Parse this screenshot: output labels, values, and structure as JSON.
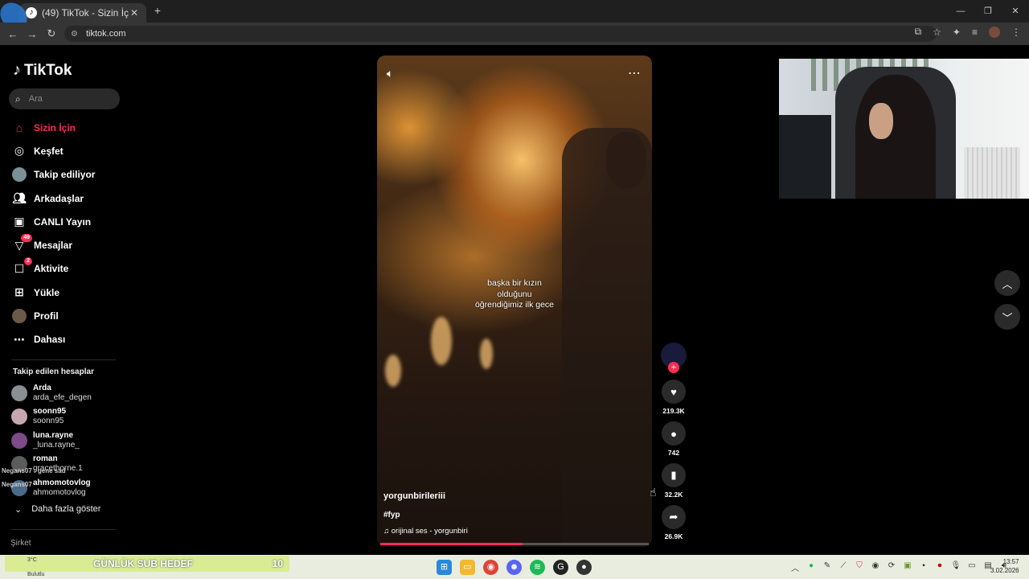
{
  "browser": {
    "tab_title": "(49) TikTok - Sizin İçin",
    "url": "tiktok.com",
    "tab_close": "✕",
    "new_tab": "+"
  },
  "sidebar": {
    "logo": "TikTok",
    "search_placeholder": "Ara",
    "nav": [
      {
        "label": "Sizin İçin",
        "icon": "home-icon",
        "active": true
      },
      {
        "label": "Keşfet",
        "icon": "compass-icon"
      },
      {
        "label": "Takip ediliyor",
        "icon": "avatar"
      },
      {
        "label": "Arkadaşlar",
        "icon": "friends-icon"
      },
      {
        "label": "CANLI Yayın",
        "icon": "live-icon"
      },
      {
        "label": "Mesajlar",
        "icon": "messages-icon",
        "badge": "49"
      },
      {
        "label": "Aktivite",
        "icon": "activity-icon",
        "badge": "2"
      },
      {
        "label": "Yükle",
        "icon": "upload-icon"
      },
      {
        "label": "Profil",
        "icon": "avatar"
      },
      {
        "label": "Dahası",
        "icon": "more-icon"
      }
    ],
    "following_title": "Takip edilen hesaplar",
    "following": [
      {
        "name": "Arda",
        "handle": "arda_efe_degen"
      },
      {
        "name": "soonn95",
        "handle": "soonn95"
      },
      {
        "name": "luna.rayne",
        "handle": "_luna.rayne_"
      },
      {
        "name": "roman",
        "handle": "gracethorne.1"
      },
      {
        "name": "ahmomotovlog",
        "handle": "ahmomotovlog"
      }
    ],
    "show_more": "Daha fazla göster",
    "company": "Şirket",
    "chat_overlay_1": "Negans07 : gene sad",
    "chat_overlay_2": "Negans07"
  },
  "video": {
    "caption": "başka bir kızın olduğunu öğrendiğimiz ilk gece",
    "username": "yorgunbirileriii",
    "hashtag": "#fyp",
    "music": "orijinal ses - yorgunbiri",
    "progress": 0.53
  },
  "actions": {
    "likes": "219.3K",
    "comments": "742",
    "saves": "32.2K",
    "shares": "26.9K"
  },
  "taskbar": {
    "temperature": "3°C",
    "weather": "Bulutlu",
    "sub_goal_label": "GÜNLÜK SUB HEDEF",
    "sub_goal_count": "10",
    "time": "13:57",
    "date": "3.02.2026"
  }
}
